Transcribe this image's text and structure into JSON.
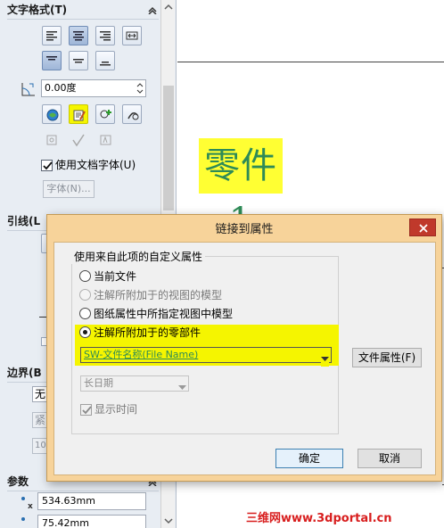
{
  "property_manager": {
    "text_format_header": "文字格式(T)",
    "angle_value": "0.00度",
    "use_doc_font_label": "使用文档字体(U)",
    "use_doc_font_checked": true,
    "font_button": "字体(N)...",
    "leader_header": "引线(L",
    "border_header": "边界(B",
    "border_value": "无",
    "border_row2": "紧",
    "border_row3": "10",
    "params_header": "参数",
    "param_x": "534.63mm",
    "param_y": "75.42mm"
  },
  "drawing": {
    "note_text": "零件1",
    "note_color": "#2e8b57",
    "highlight_color": "#ffff33"
  },
  "dialog": {
    "title": "链接到属性",
    "group_label": "使用来自此项的自定义属性",
    "options": [
      {
        "label": "当前文件",
        "enabled": true,
        "selected": false
      },
      {
        "label": "注解所附加于的视图的模型",
        "enabled": false,
        "selected": false
      },
      {
        "label": "图纸属性中所指定视图中模型",
        "enabled": true,
        "selected": false
      },
      {
        "label": "注解所附加于的零部件",
        "enabled": true,
        "selected": true
      }
    ],
    "property_combo": "SW-文件名称(File Name)",
    "date_combo": "长日期",
    "show_time_label": "显示时间",
    "show_time_checked": true,
    "file_properties_button": "文件属性(F)",
    "ok_button": "确定",
    "cancel_button": "取消"
  },
  "watermark": "三维网www.3dportal.cn",
  "colors": {
    "dialog_frame": "#f7d39a",
    "close_button": "#c0392b",
    "highlight": "#f5f500",
    "pm_background": "#e8edf3"
  }
}
